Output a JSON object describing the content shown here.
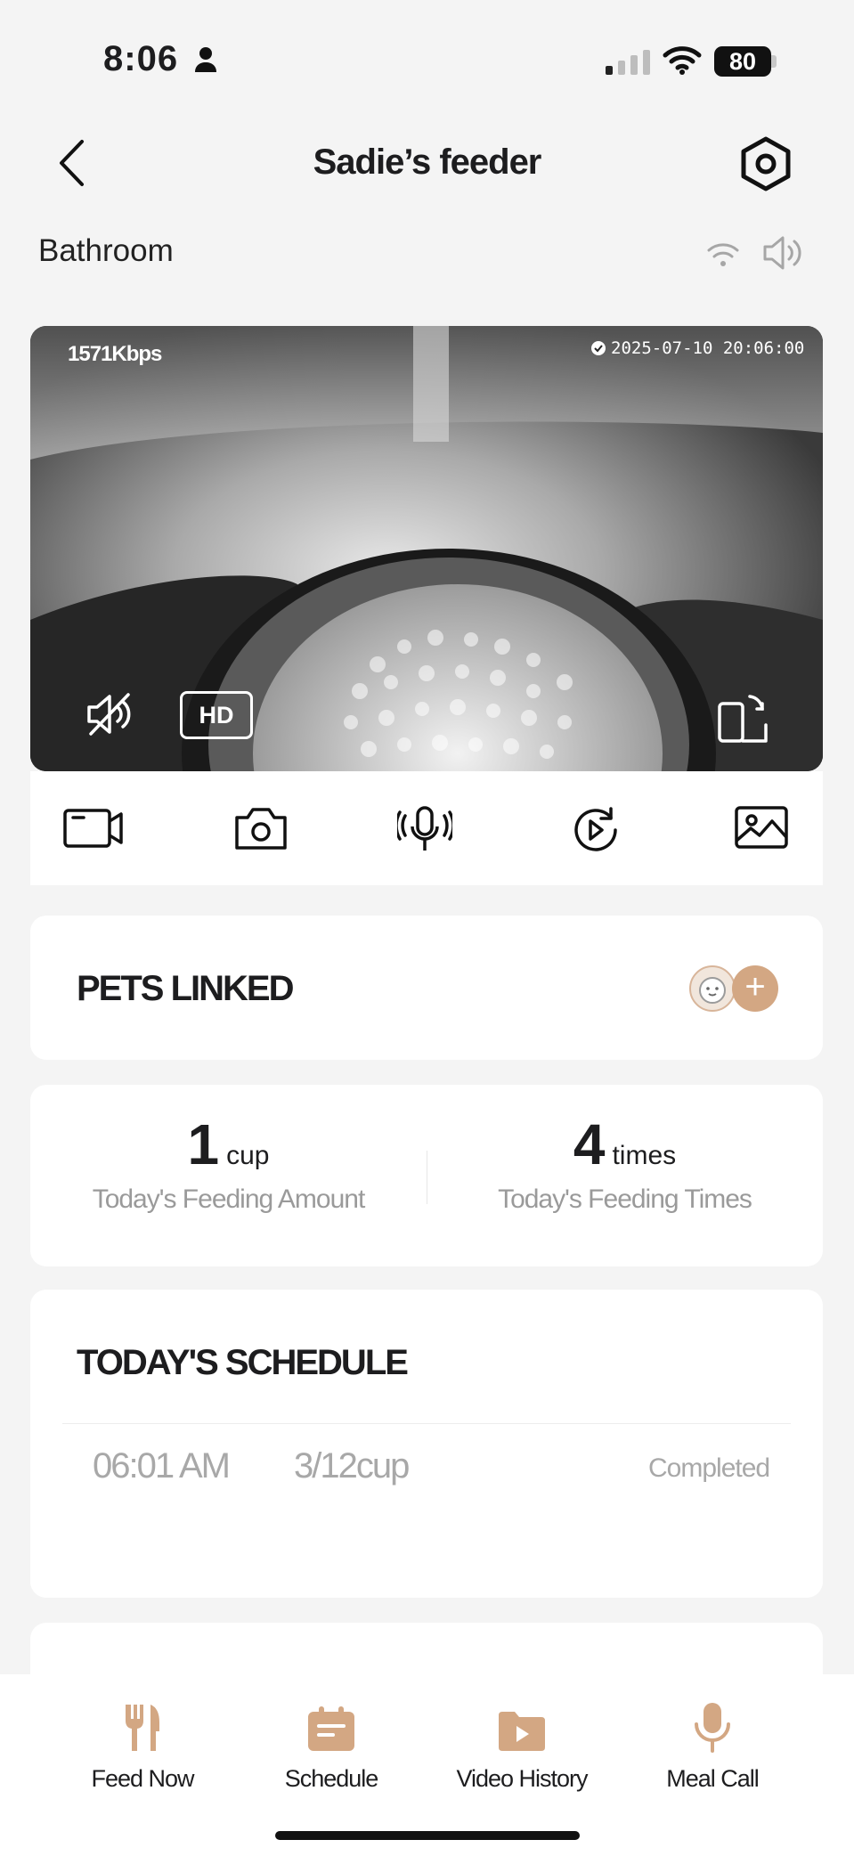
{
  "status_bar": {
    "time": "8:06",
    "battery": "80"
  },
  "header": {
    "title": "Sadie’s feeder",
    "location": "Bathroom"
  },
  "camera": {
    "bitrate": "1571Kbps",
    "timestamp": "2025-07-10 20:06:00",
    "quality_label": "HD"
  },
  "toolbar_icons": [
    "record-video-icon",
    "snapshot-camera-icon",
    "microphone-talk-icon",
    "replay-icon",
    "gallery-icon"
  ],
  "pets_linked": {
    "title": "PETS LINKED"
  },
  "stats": {
    "amount_value": "1",
    "amount_unit": "cup",
    "amount_label": "Today's Feeding Amount",
    "times_value": "4",
    "times_unit": "times",
    "times_label": "Today's Feeding Times"
  },
  "schedule": {
    "title": "TODAY'S SCHEDULE",
    "items": [
      {
        "time": "06:01 AM",
        "amount": "3/12cup",
        "status": "Completed"
      }
    ]
  },
  "bottom_nav": [
    {
      "label": "Feed Now",
      "icon": "fork-knife-icon"
    },
    {
      "label": "Schedule",
      "icon": "calendar-icon"
    },
    {
      "label": "Video History",
      "icon": "video-play-icon"
    },
    {
      "label": "Meal Call",
      "icon": "microphone-icon"
    }
  ],
  "colors": {
    "accent": "#d3a783",
    "background": "#f4f4f4",
    "card": "#ffffff",
    "muted_text": "#a8a8a8"
  }
}
